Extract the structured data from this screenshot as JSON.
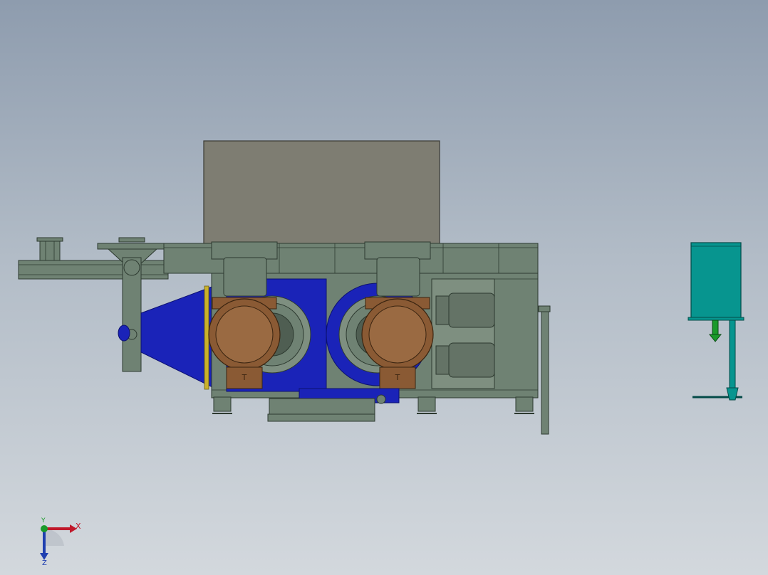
{
  "viewport": {
    "background_top": "#8e9cae",
    "background_bottom": "#d3d8dd"
  },
  "colors": {
    "frame": "#6f8273",
    "frame_dark": "#4f5e52",
    "hopper": "#7e7d72",
    "roller_blue": "#1a23b8",
    "motor_bronze": "#8a5a34",
    "cylinder": "#647366",
    "panel_teal": "#07958f",
    "triad_x": "#c0182a",
    "triad_y": "#1a9a2a",
    "triad_z": "#1f3fb0"
  },
  "triad": {
    "x_label": "X",
    "y_label": "Y",
    "z_label": "Z"
  }
}
